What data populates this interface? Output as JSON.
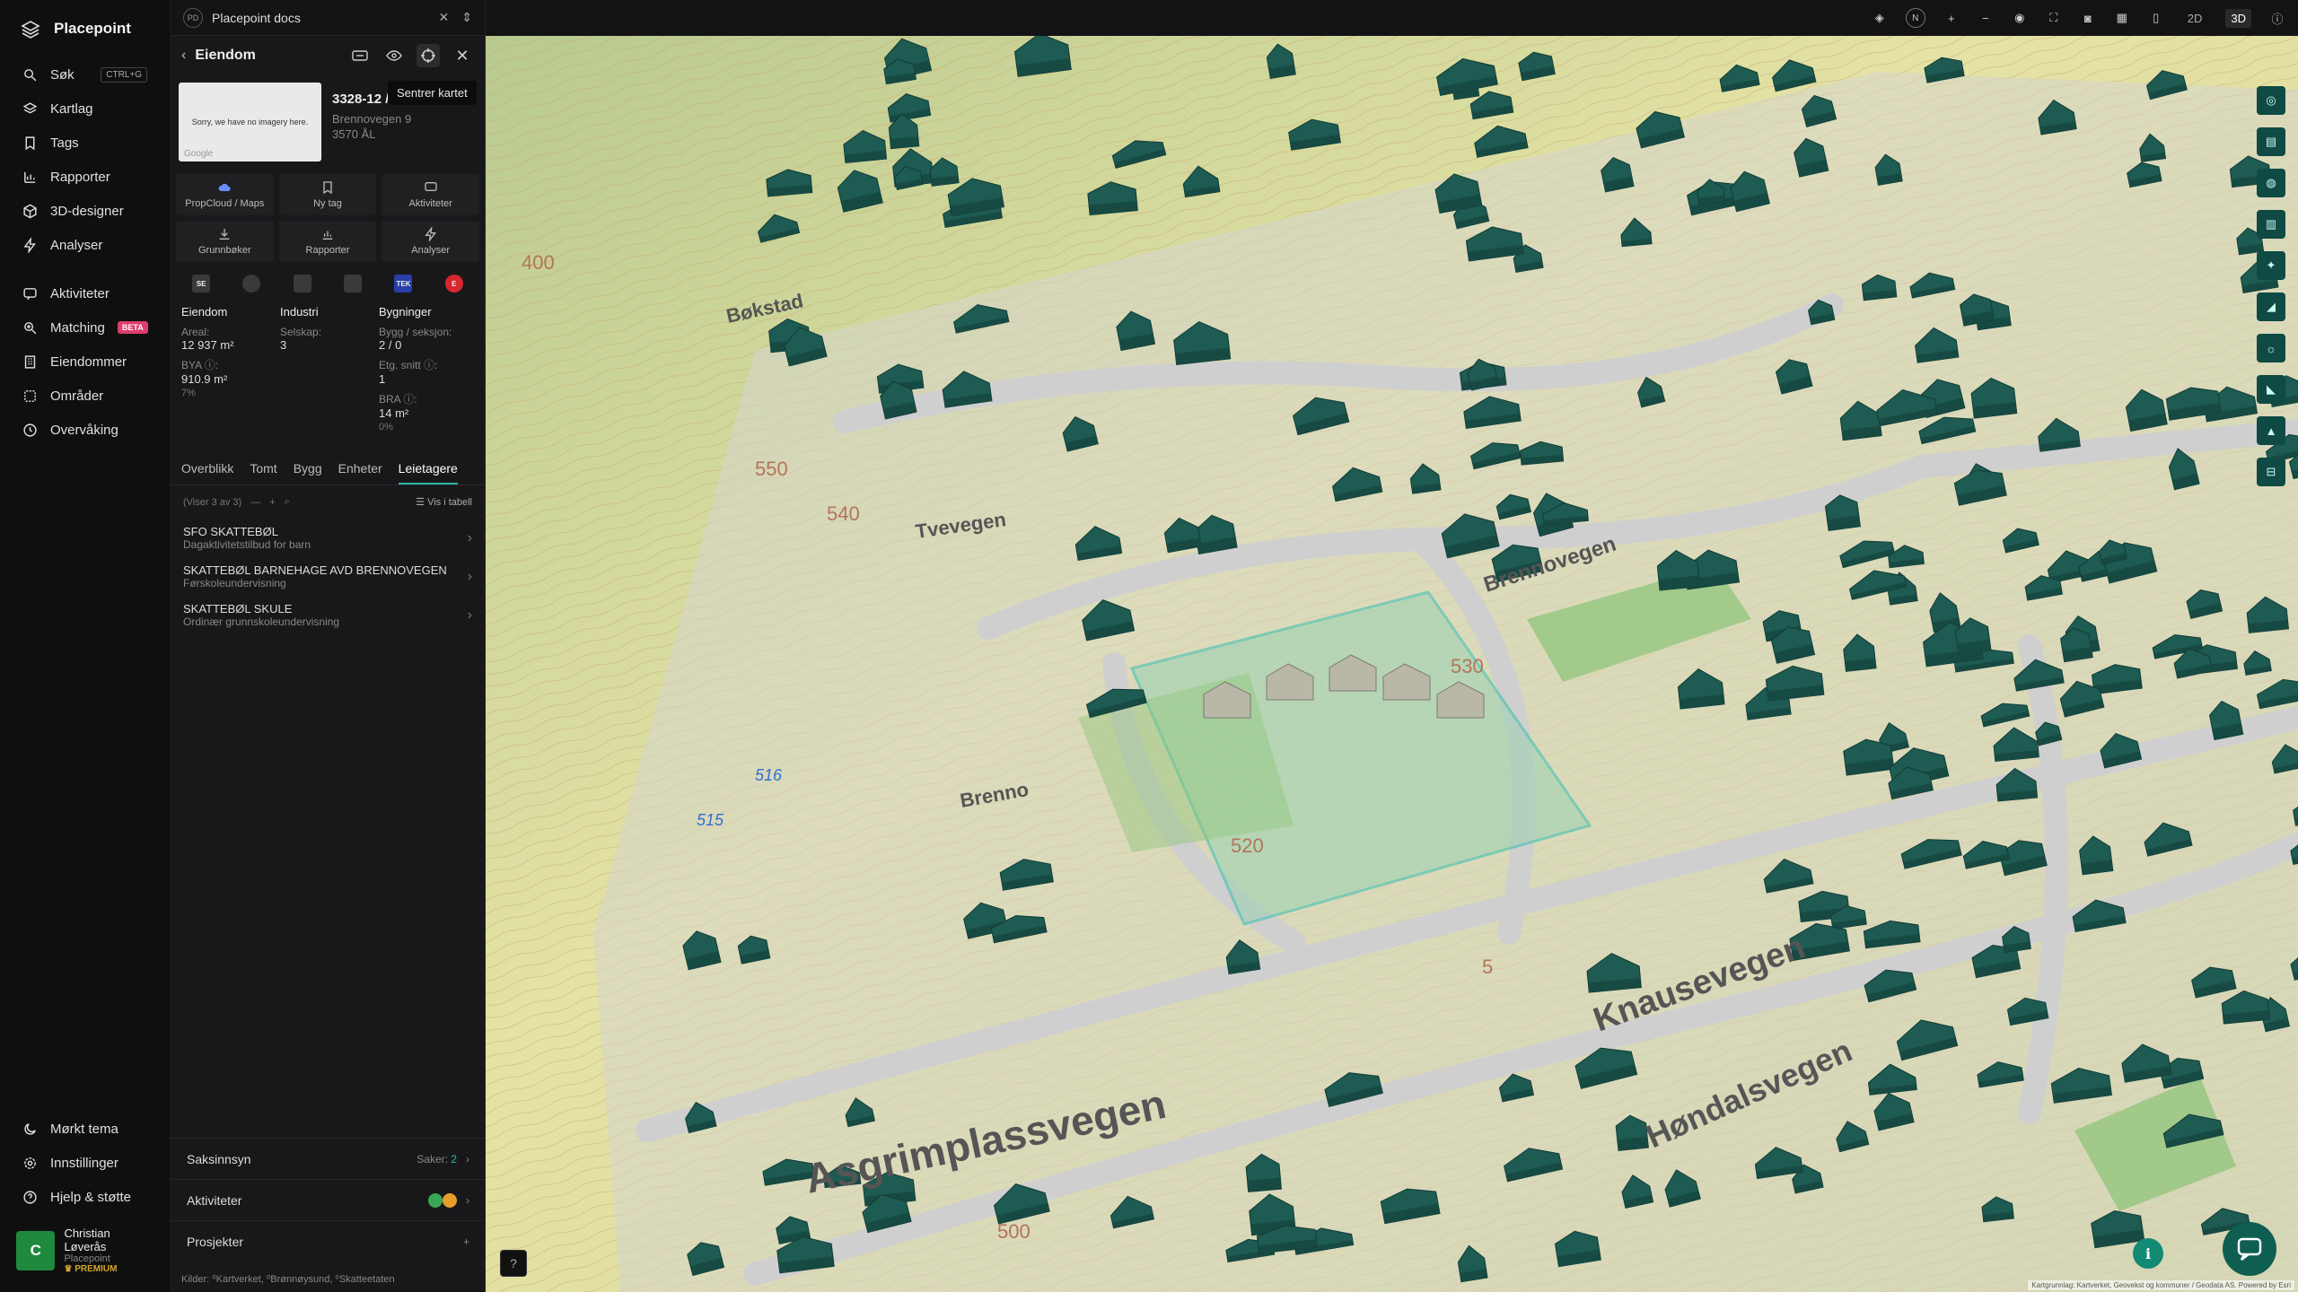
{
  "brand": {
    "name": "Placepoint"
  },
  "nav": {
    "items": [
      {
        "label": "Søk",
        "kbd": "CTRL+G"
      },
      {
        "label": "Kartlag"
      },
      {
        "label": "Tags"
      },
      {
        "label": "Rapporter"
      },
      {
        "label": "3D-designer"
      },
      {
        "label": "Analyser"
      },
      {
        "label": "Aktiviteter"
      },
      {
        "label": "Matching",
        "badge": "BETA"
      },
      {
        "label": "Eiendommer"
      },
      {
        "label": "Områder"
      },
      {
        "label": "Overvåking"
      }
    ],
    "bottom": [
      {
        "label": "Mørkt tema"
      },
      {
        "label": "Innstillinger"
      },
      {
        "label": "Hjelp & støtte"
      }
    ],
    "user": {
      "initial": "C",
      "name": "Christian Løverås",
      "org": "Placepoint",
      "plan": "PREMIUM"
    }
  },
  "docs": {
    "badge": "PD",
    "title": "Placepoint docs"
  },
  "panel": {
    "title": "Eiendom",
    "tooltip": "Sentrer kartet",
    "thumb_text": "Sorry, we have no imagery here.",
    "thumb_credit": "Google",
    "property_id": "3328-12 / 27 / 0 / 0",
    "address_line1": "Brennovegen 9",
    "address_line2": "3570 ÅL",
    "actions": [
      "PropCloud / Maps",
      "Ny tag",
      "Aktiviteter",
      "Grunnbøker",
      "Rapporter",
      "Analyser"
    ],
    "sources": [
      "SE",
      "",
      "",
      "",
      "TEK",
      "E"
    ],
    "stats": {
      "col1": {
        "title": "Eiendom",
        "l1": "Areal:",
        "v1": "12 937 m²",
        "l2": "BYA ⓘ:",
        "v2": "910.9 m²",
        "p2": "7%"
      },
      "col2": {
        "title": "Industri",
        "l1": "Selskap:",
        "v1": "3"
      },
      "col3": {
        "title": "Bygninger",
        "l1": "Bygg / seksjon:",
        "v1": "2 / 0",
        "l2": "Etg. snitt ⓘ:",
        "v2": "1",
        "l3": "BRA ⓘ:",
        "v3": "14 m²",
        "p3": "0%"
      }
    },
    "tabs": [
      "Overblikk",
      "Tomt",
      "Bygg",
      "Enheter",
      "Leietagere"
    ],
    "list_meta": "(Viser 3 av 3)",
    "list_view": "Vis i tabell",
    "tenants": [
      {
        "name": "SFO SKATTEBØL",
        "category": "Dagaktivitetstilbud for barn"
      },
      {
        "name": "SKATTEBØL BARNEHAGE AVD BRENNOVEGEN",
        "category": "Førskoleundervisning"
      },
      {
        "name": "SKATTEBØL SKULE",
        "category": "Ordinær grunnskoleundervisning"
      }
    ],
    "sections": {
      "saksinnsyn": {
        "label": "Saksinnsyn",
        "count_label": "Saker:",
        "count": "2"
      },
      "aktiviteter": {
        "label": "Aktiviteter"
      },
      "prosjekter": {
        "label": "Prosjekter"
      }
    },
    "footer": "Kilder: ⁰Kartverket, ⁰Brønnøysund, ⁰Skatteetaten"
  },
  "topbar": {
    "view_2d": "2D",
    "view_3d": "3D",
    "compass": "N"
  },
  "map": {
    "roads": [
      "Asgrimplassvegen",
      "Knausevegen",
      "Høndalsvegen",
      "Brennovegen",
      "Tvevegen",
      "Brenno",
      "Bøkstad"
    ],
    "contours": [
      "550",
      "540",
      "530",
      "520",
      "516",
      "515",
      "500",
      "400",
      "5"
    ],
    "attribution": "Kartgrunnlag: Kartverket, Geovekst og kommuner / Geodata AS. Powered by Esri",
    "colors": {
      "terrain": "#d9dd9a",
      "building": "#1e5b52",
      "parcel": "#3fc0b2",
      "accent": "#2fb5a5"
    }
  }
}
